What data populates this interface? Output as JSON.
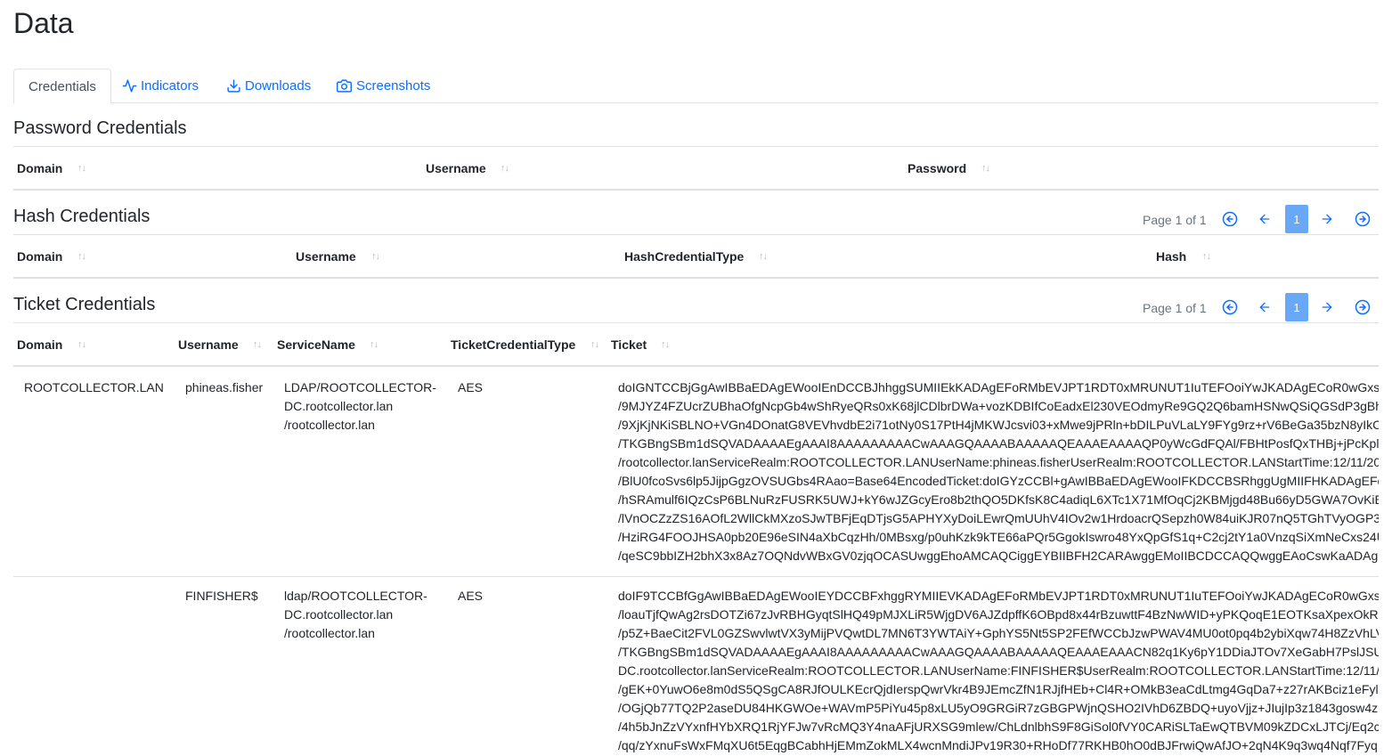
{
  "page": {
    "title": "Data"
  },
  "tabs": [
    {
      "label": "Credentials",
      "icon": "none",
      "active": true
    },
    {
      "label": "Indicators",
      "icon": "activity-icon"
    },
    {
      "label": "Downloads",
      "icon": "download-icon"
    },
    {
      "label": "Screenshots",
      "icon": "camera-icon"
    }
  ],
  "password_credentials": {
    "title": "Password Credentials",
    "columns": [
      "Domain",
      "Username",
      "Password"
    ]
  },
  "hash_credentials": {
    "title": "Hash Credentials",
    "pager": {
      "text": "Page 1 of 1",
      "current": "1"
    },
    "columns": [
      "Domain",
      "Username",
      "HashCredentialType",
      "Hash"
    ]
  },
  "ticket_credentials": {
    "title": "Ticket Credentials",
    "pager": {
      "text": "Page 1 of 1",
      "current": "1"
    },
    "columns": [
      "Domain",
      "Username",
      "ServiceName",
      "TicketCredentialType",
      "Ticket"
    ],
    "rows": [
      {
        "domain": "ROOTCOLLECTOR.LAN",
        "username": "phineas.fisher",
        "service": [
          "LDAP/ROOTCOLLECTOR-",
          "DC.rootcollector.lan",
          "/rootcollector.lan"
        ],
        "type": "AES",
        "ticket": [
          "doIGNTCCBjGgAwIBBaEDAgEWooIEnDCCBJhhggSUMIIEkKADAgEFoRMbEVJPT1RDT0xMRUNUT1IuTEFOoiYwJKADAgECoR0wGxs",
          "/9MJYZ4FZUcrZUBhaOfgNcpGb4wShRyeQRs0xK68jlCDlbrDWa+vozKDBIfCoEadxEl230VEOdmyRe9GQ2Q6bamHSNwQSiQGSdP3gBh",
          "/9XjKjNKiSBLNO+VGn4DOnatG8VEVhvdbE2i71otNy0S17PtH4jMKWJcsvi03+xMwe9jPRln+bDILPuVLaLY9FYg9rz+rV6BeGa35bzN8yIkC",
          "/TKGBngSBm1dSQVADAAAAEgAAAI8AAAAAAAAACwAAAGQAAAABAAAAAQEAAAEAAAAQP0yWcGdFQAl/FBHtPosfQxTHBj+jPcKpl",
          "/rootcollector.lanServiceRealm:ROOTCOLLECTOR.LANUserName:phineas.fisherUserRealm:ROOTCOLLECTOR.LANStartTime:12/11/20",
          "/BlU0fcoSvs6lp5JijpGgzOVSUGbs4RAao=Base64EncodedTicket:doIGYzCCBl+gAwIBBaEDAgEWooIFKDCCBSRhggUgMIIFHKADAgEFo",
          "/hSRAmulf6IQzCsP6BLNuRzFUSRK5UWJ+kY6wJZGcyEro8b2thQO5DKfsK8C4adiqL6XTc1X71MfOqCj2KBMjgd48Bu66yD5GWA7OvKiE",
          "/lVnOCZzZS16AOfL2WllCkMXzoSJwTBFjEqDTjsG5APHYXyDoiLEwrQmUUhV4IOv2w1HrdoacrQSepzh0W84uiKJR07nQ5TGhTVyOGP3",
          "/HziRG4FOOJHSA0pb20E96eSIN4aXbCqzHh/0MBsxg/p0uhKzk9kTE66aPQr5GgokIswro48YxQpGfS1q+C2cj2tY1a0VnzqSiXmNeCxs24U",
          "/qeSC9bbIZH2bhX3x8Az7OQNdvWBxGV0zjqOCASUwggEhoAMCAQCiggEYBIIBFH2CARAwggEMoIIBCDCCAQQwggEAoCswKaADAg"
        ]
      },
      {
        "domain": "",
        "username": "FINFISHER$",
        "service": [
          "ldap/ROOTCOLLECTOR-",
          "DC.rootcollector.lan",
          "/rootcollector.lan"
        ],
        "type": "AES",
        "ticket": [
          "doIF9TCCBfGgAwIBBaEDAgEWooIEYDCCBFxhggRYMIIEVKADAgEFoRMbEVJPT1RDT0xMRUNUT1IuTEFOoiYwJKADAgECoR0wGxs",
          "/loauTjfQwAg2rsDOTZi67zJvRBHGyqtSlHQ49pMJXLiR5WjgDV6AJZdpffK6OBpd8x44rBzuwttF4BzNwWID+yPKQoqE1EOTKsaXpexOkR",
          "/p5Z+BaeCit2FVL0GZSwvlwtVX3yMijPVQwtDL7MN6T3YWTAiY+GphYS5Nt5SP2FEfWCCbJzwPWAV4MU0ot0pq4b2ybiXqw74H8ZzVhLV",
          "/TKGBngSBm1dSQVADAAAAEgAAAI8AAAAAAAAACwAAAGQAAAABAAAAAQEAAAEAAACN82q1Ky6pY1DDiaJTOv7XeGabH7PslJSU",
          "DC.rootcollector.lanServiceRealm:ROOTCOLLECTOR.LANUserName:FINFISHER$UserRealm:ROOTCOLLECTOR.LANStartTime:12/11/",
          "/gEK+0YuwO6e8m0dS5QSgCA8RJfOULKEcrQjdIerspQwrVkr4B9JEmcZfN1RJjfHEb+Cl4R+OMkB3eaCdLtmg4GqDa7+z27rAKBciz1eFyl",
          "/OGjQb77TQ2P2aseDU84HKGWOe+WAVmP5PiYu45p8xLU5yO9GRGiR7zGBGPWjnQSHO2IVhD6ZBDQ+uyoVjjz+JIujIp3z1843gosw4z",
          "/4h5bJnZzVYxnfHYbXRQ1RjYFJw7vRcMQ3Y4naAFjURXSG9mlew/ChLdnlbhS9F8GiSol0fVY0CARiSLTaEwQTBVM09kZDCxLJTCj/Eq2c",
          "/qq/zYxnuFsWxFMqXU6t5EqgBCabhHjEMmZokMLX4wcnMndiJPv19R30+RHoDf77RKHB0hO0dBJFrwiQwAfJO+2qN4K9q3wq4Nqf7Fyq"
        ]
      }
    ]
  }
}
